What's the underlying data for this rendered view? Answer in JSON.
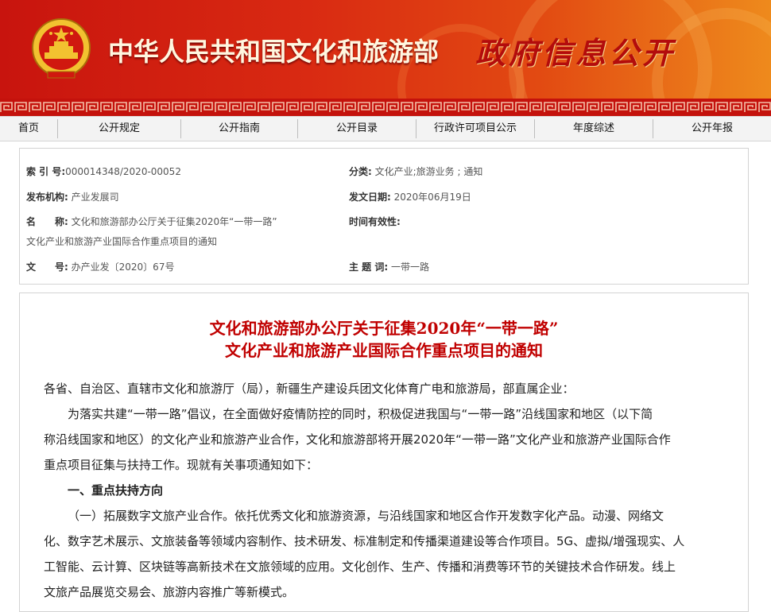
{
  "banner": {
    "org_name": "中华人民共和国文化和旅游部",
    "section_title": "政府信息公开",
    "colors": {
      "red": "#c8140e",
      "orange": "#ee8a1c",
      "cream": "#fff7e0"
    }
  },
  "nav": {
    "items": [
      "首页",
      "公开规定",
      "公开指南",
      "公开目录",
      "行政许可项目公示",
      "年度综述",
      "公开年报"
    ]
  },
  "meta": {
    "index_label": "索 引 号:",
    "index_value": "000014348/2020-00052",
    "category_label": "分类:",
    "category_value": "文化产业;旅游业务 ; 通知",
    "issuer_label": "发布机构:",
    "issuer_value": "产业发展司",
    "date_label": "发文日期:",
    "date_value": "2020年06月19日",
    "name_label": "名　　称:",
    "name_value_1": "文化和旅游部办公厅关于征集2020年“一带一路”",
    "name_value_2": "文化产业和旅游产业国际合作重点项目的通知",
    "validity_label": "时间有效性:",
    "doc_no_label": "文　　号:",
    "doc_no_value": "办产业发〔2020〕67号",
    "keyword_label": "主 题 词:",
    "keyword_value": "一带一路"
  },
  "document": {
    "title_line1": "文化和旅游部办公厅关于征集2020年“一带一路”",
    "title_line2": "文化产业和旅游产业国际合作重点项目的通知",
    "salutation": "各省、自治区、直辖市文化和旅游厅（局），新疆生产建设兵团文化体育广电和旅游局，部直属企业：",
    "intro_1": "为落实共建“一带一路”倡议，在全面做好疫情防控的同时，积极促进我国与“一带一路”沿线国家和地区（以下简",
    "intro_2": "称沿线国家和地区）的文化产业和旅游产业合作，文化和旅游部将开展2020年“一带一路”文化产业和旅游产业国际合作",
    "intro_3": "重点项目征集与扶持工作。现就有关事项通知如下：",
    "section_1": "一、重点扶持方向",
    "item_1_line1": "（一）拓展数字文旅产业合作。依托优秀文化和旅游资源，与沿线国家和地区合作开发数字化产品。动漫、网络文",
    "item_1_line2": "化、数字艺术展示、文旅装备等领域内容制作、技术研发、标准制定和传播渠道建设等合作项目。5G、虚拟/增强现实、人",
    "item_1_line3": "工智能、云计算、区块链等高新技术在文旅领域的应用。文化创作、生产、传播和消费等环节的关键技术合作研发。线上",
    "item_1_line4": "文旅产品展览交易会、旅游内容推广等新模式。"
  }
}
